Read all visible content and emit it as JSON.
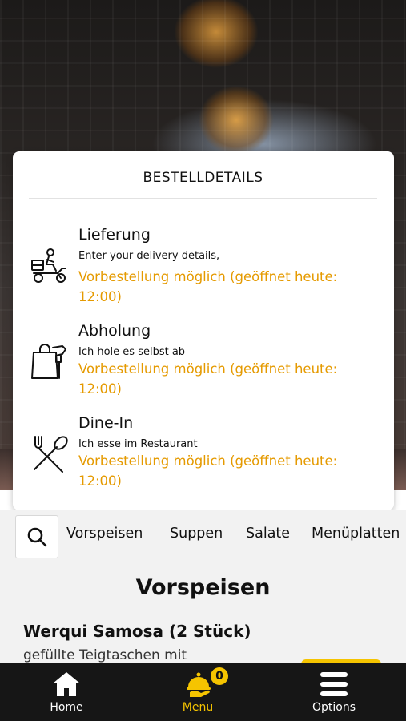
{
  "modal": {
    "title": "BESTELLDETAILS",
    "options": [
      {
        "icon": "delivery-scooter-icon",
        "title": "Lieferung",
        "subtitle": "Enter your delivery details,",
        "note": "Vorbestellung möglich (geöffnet heute: 12:00)"
      },
      {
        "icon": "takeaway-bag-icon",
        "title": "Abholung",
        "subtitle": "Ich hole es selbst ab",
        "note": "Vorbestellung möglich (geöffnet heute: 12:00)"
      },
      {
        "icon": "fork-spoon-icon",
        "title": "Dine-In",
        "subtitle": "Ich esse im Restaurant",
        "note": "Vorbestellung möglich (geöffnet heute: 12:00)"
      }
    ]
  },
  "categories": [
    "Vorspeisen",
    "Suppen",
    "Salate",
    "Menüplatten"
  ],
  "section": {
    "title": "Vorspeisen",
    "item_name": "Werqui Samosa (2 Stück)",
    "item_desc": "gefüllte Teigtaschen mit"
  },
  "nav": {
    "home": "Home",
    "menu": "Menu",
    "options": "Options",
    "cart_count": "0"
  },
  "colors": {
    "accent": "#f5c400",
    "note": "#e59a00",
    "nav_bg": "#161616"
  }
}
